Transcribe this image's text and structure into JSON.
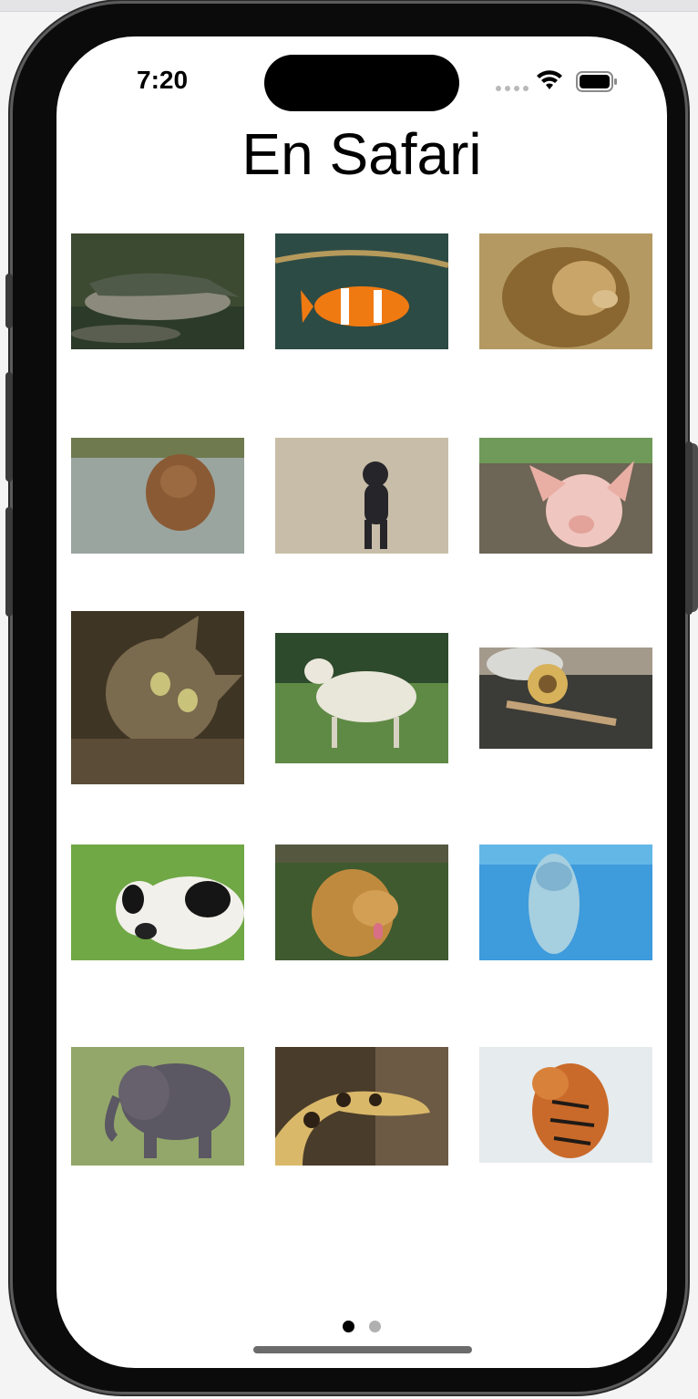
{
  "status_bar": {
    "time": "7:20"
  },
  "header": {
    "title": "En Safari"
  },
  "grid": {
    "items": [
      {
        "name": "crocodile"
      },
      {
        "name": "clownfish"
      },
      {
        "name": "lion"
      },
      {
        "name": "bear"
      },
      {
        "name": "chimpanzee"
      },
      {
        "name": "pig"
      },
      {
        "name": "cat"
      },
      {
        "name": "lamb"
      },
      {
        "name": "snail"
      },
      {
        "name": "cow"
      },
      {
        "name": "dog"
      },
      {
        "name": "dolphin"
      },
      {
        "name": "elephant"
      },
      {
        "name": "snake"
      },
      {
        "name": "tiger"
      }
    ]
  },
  "pager": {
    "pages": 2,
    "current": 1,
    "active_color": "#000000",
    "inactive_color": "#b0b0b0"
  },
  "icons": [
    "wifi-icon",
    "battery-icon",
    "signal-icon"
  ]
}
